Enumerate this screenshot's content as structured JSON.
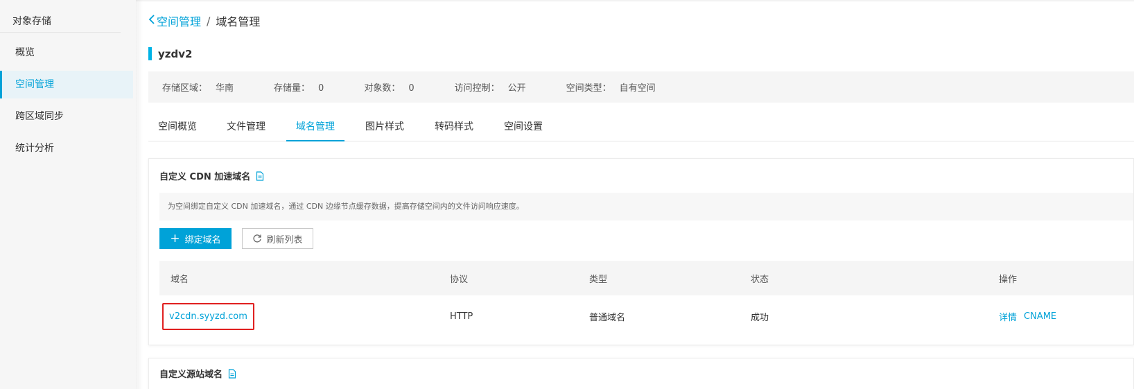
{
  "sidebar": {
    "title": "对象存储",
    "items": [
      {
        "label": "概览"
      },
      {
        "label": "空间管理"
      },
      {
        "label": "跨区域同步"
      },
      {
        "label": "统计分析"
      }
    ]
  },
  "breadcrumb": {
    "back_label": "空间管理",
    "separator": "/",
    "current": "域名管理"
  },
  "bucket": {
    "name": "yzdv2",
    "info": [
      {
        "label": "存储区域：",
        "value": "华南"
      },
      {
        "label": "存储量：",
        "value": "0"
      },
      {
        "label": "对象数：",
        "value": "0"
      },
      {
        "label": "访问控制：",
        "value": "公开"
      },
      {
        "label": "空间类型：",
        "value": "自有空间"
      }
    ]
  },
  "tabs": [
    {
      "label": "空间概览"
    },
    {
      "label": "文件管理"
    },
    {
      "label": "域名管理"
    },
    {
      "label": "图片样式"
    },
    {
      "label": "转码样式"
    },
    {
      "label": "空间设置"
    }
  ],
  "cdn_panel": {
    "title": "自定义 CDN 加速域名",
    "description": "为空间绑定自定义 CDN 加速域名，通过 CDN 边缘节点缓存数据，提高存储空间内的文件访问响应速度。",
    "bind_button": "绑定域名",
    "refresh_button": "刷新列表",
    "columns": [
      "域名",
      "协议",
      "类型",
      "状态",
      "操作"
    ],
    "rows": [
      {
        "domain": "v2cdn.syyzd.com",
        "protocol": "HTTP",
        "type": "普通域名",
        "status": "成功",
        "actions": [
          "详情",
          "CNAME"
        ]
      }
    ]
  },
  "source_panel": {
    "title": "自定义源站域名"
  },
  "colors": {
    "accent": "#00a2d8",
    "highlight_border": "#e02020",
    "title_bar": "#00b3e6"
  }
}
